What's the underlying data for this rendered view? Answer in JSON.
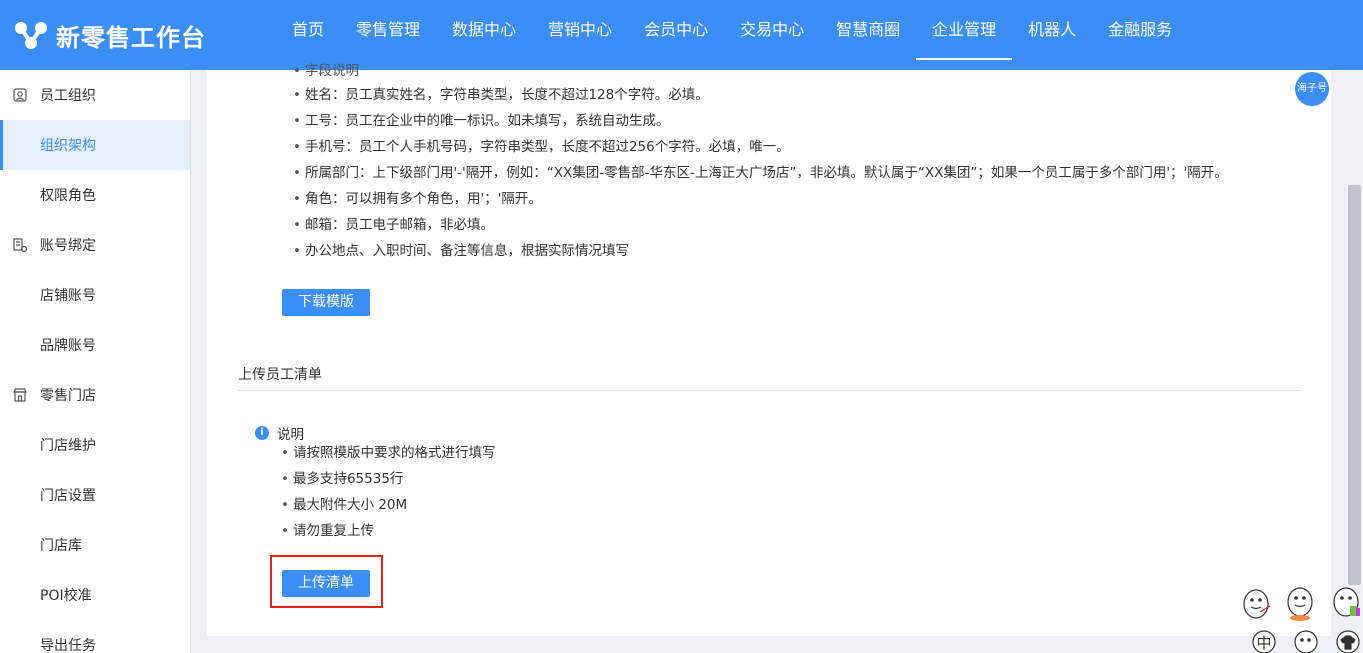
{
  "header": {
    "app_title": "新零售工作台",
    "nav": [
      "首页",
      "零售管理",
      "数据中心",
      "营销中心",
      "会员中心",
      "交易中心",
      "智慧商圈",
      "企业管理",
      "机器人",
      "金融服务"
    ],
    "active_nav": "企业管理",
    "bg_color": "#3a8ef6"
  },
  "sidebar": {
    "items": [
      {
        "label": "员工组织",
        "group": true,
        "icon": "user-icon"
      },
      {
        "label": "组织架构",
        "group": false,
        "active": true
      },
      {
        "label": "权限角色",
        "group": false
      },
      {
        "label": "账号绑定",
        "group": true,
        "icon": "link-icon"
      },
      {
        "label": "店铺账号",
        "group": false
      },
      {
        "label": "品牌账号",
        "group": false
      },
      {
        "label": "零售门店",
        "group": true,
        "icon": "store-icon"
      },
      {
        "label": "门店维护",
        "group": false
      },
      {
        "label": "门店设置",
        "group": false
      },
      {
        "label": "门店库",
        "group": false
      },
      {
        "label": "POI校准",
        "group": false
      },
      {
        "label": "导出任务",
        "group": false
      }
    ]
  },
  "field_notes": {
    "heading_partial": "字段说明",
    "items": [
      "姓名：员工真实姓名，字符串类型，长度不超过128个字符。必填。",
      "工号：员工在企业中的唯一标识。如未填写，系统自动生成。",
      "手机号：员工个人手机号码，字符串类型，长度不超过256个字符。必填，唯一。",
      "所属部门：上下级部门用'-'隔开，例如：“XX集团-零售部-华东区-上海正大广场店”，非必填。默认属于“XX集团”；如果一个员工属于多个部门用'；'隔开。",
      "角色：可以拥有多个角色，用'；'隔开。",
      "邮箱：员工电子邮箱，非必填。",
      "办公地点、入职时间、备注等信息，根据实际情况填写"
    ]
  },
  "download_button": "下载模版",
  "upload_section": {
    "title": "上传员工清单",
    "note_title": "说明",
    "note_icon_text": "i",
    "items": [
      "请按照模版中要求的格式进行填写",
      "最多支持65535行",
      "最大附件大小 20M",
      "请勿重复上传"
    ],
    "upload_button": "上传清单"
  },
  "avatar_text": "海子号",
  "sticker": {
    "label": "中"
  }
}
